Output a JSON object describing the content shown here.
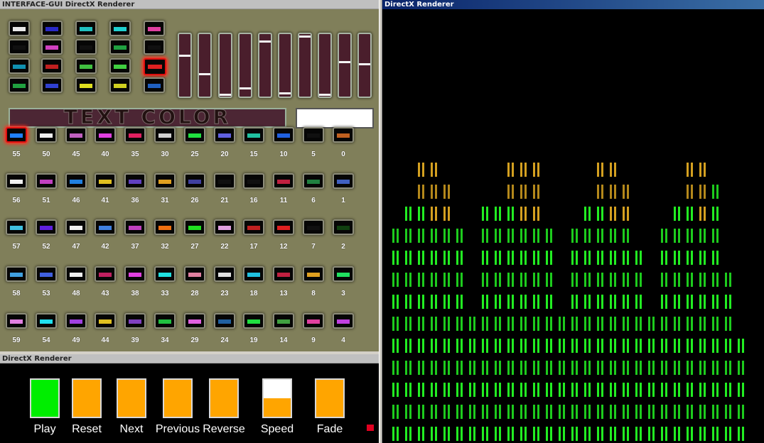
{
  "windows": {
    "gui_title": "INTERFACE-GUI   DirectX Renderer",
    "controls_title": "DirectX Renderer",
    "visualizer_title": "DirectX Renderer"
  },
  "text_color": {
    "label": "TEXT COLOR",
    "value": ""
  },
  "sliders": [
    {
      "level": 0.67
    },
    {
      "level": 0.35
    },
    {
      "level": 0.0
    },
    {
      "level": 0.11
    },
    {
      "level": 0.92
    },
    {
      "level": 0.03
    },
    {
      "level": 1.0
    },
    {
      "level": 0.0
    },
    {
      "level": 0.56
    },
    {
      "level": 0.53
    }
  ],
  "effect_grid_colors": [
    [
      "#e8e8e8",
      "#2a2ac8",
      "#20c0c0",
      "#20d0d0",
      "#e040a0"
    ],
    [
      "#101010",
      "#d040c0",
      "#101010",
      "#20a040",
      "#101010"
    ],
    [
      "#1090b0",
      "#c02020",
      "#40c040",
      "#40d040",
      "#e02020"
    ],
    [
      "#20a040",
      "#3040d0",
      "#e0e020",
      "#d0d020",
      "#2060c0"
    ]
  ],
  "effect_grid_selected": [
    2,
    4
  ],
  "presets": [
    [
      {
        "n": "55",
        "c": "#2080ff",
        "sel": true
      },
      {
        "n": "50",
        "c": "#f0f0f0"
      },
      {
        "n": "45",
        "c": "#c060c0"
      },
      {
        "n": "40",
        "c": "#e040e0"
      },
      {
        "n": "35",
        "c": "#e02060"
      },
      {
        "n": "30",
        "c": "#d0d0d0"
      },
      {
        "n": "25",
        "c": "#20e040"
      },
      {
        "n": "20",
        "c": "#6060e0"
      },
      {
        "n": "15",
        "c": "#20c0a0"
      },
      {
        "n": "10",
        "c": "#2060e0"
      },
      {
        "n": "5",
        "c": "#101010"
      },
      {
        "n": "0",
        "c": "#c06020"
      }
    ],
    [
      {
        "n": "56",
        "c": "#f0f0f0"
      },
      {
        "n": "51",
        "c": "#c040c0"
      },
      {
        "n": "46",
        "c": "#2080e0"
      },
      {
        "n": "41",
        "c": "#e0c020"
      },
      {
        "n": "36",
        "c": "#6040c0"
      },
      {
        "n": "31",
        "c": "#e0a020"
      },
      {
        "n": "26",
        "c": "#4040a0"
      },
      {
        "n": "21",
        "c": "#101010"
      },
      {
        "n": "16",
        "c": "#101010"
      },
      {
        "n": "11",
        "c": "#c02040"
      },
      {
        "n": "6",
        "c": "#208040"
      },
      {
        "n": "1",
        "c": "#4060c0"
      }
    ],
    [
      {
        "n": "57",
        "c": "#40c0e0"
      },
      {
        "n": "52",
        "c": "#6020e0"
      },
      {
        "n": "47",
        "c": "#f0f0f0"
      },
      {
        "n": "42",
        "c": "#4080e0"
      },
      {
        "n": "37",
        "c": "#c040c0"
      },
      {
        "n": "32",
        "c": "#f07010"
      },
      {
        "n": "27",
        "c": "#20e020"
      },
      {
        "n": "22",
        "c": "#e0a0e0"
      },
      {
        "n": "17",
        "c": "#c02020"
      },
      {
        "n": "12",
        "c": "#e02020"
      },
      {
        "n": "7",
        "c": "#101010"
      },
      {
        "n": "2",
        "c": "#104010"
      }
    ],
    [
      {
        "n": "58",
        "c": "#40a0e0"
      },
      {
        "n": "53",
        "c": "#4060e0"
      },
      {
        "n": "48",
        "c": "#f0f0f0"
      },
      {
        "n": "43",
        "c": "#c02060"
      },
      {
        "n": "38",
        "c": "#e040e0"
      },
      {
        "n": "33",
        "c": "#20e0e0"
      },
      {
        "n": "28",
        "c": "#e080a0"
      },
      {
        "n": "23",
        "c": "#e0e0e0"
      },
      {
        "n": "18",
        "c": "#20c0e0"
      },
      {
        "n": "13",
        "c": "#c02040"
      },
      {
        "n": "8",
        "c": "#e0a020"
      },
      {
        "n": "3",
        "c": "#20e060"
      }
    ],
    [
      {
        "n": "59",
        "c": "#e080e0"
      },
      {
        "n": "54",
        "c": "#20e0f0"
      },
      {
        "n": "49",
        "c": "#a040e0"
      },
      {
        "n": "44",
        "c": "#e0c020"
      },
      {
        "n": "39",
        "c": "#8040c0"
      },
      {
        "n": "34",
        "c": "#20c040"
      },
      {
        "n": "29",
        "c": "#e060e0"
      },
      {
        "n": "24",
        "c": "#2060a0"
      },
      {
        "n": "19",
        "c": "#20e040"
      },
      {
        "n": "14",
        "c": "#40a040"
      },
      {
        "n": "9",
        "c": "#e040a0"
      },
      {
        "n": "4",
        "c": "#c040e0"
      }
    ]
  ],
  "controls": [
    {
      "label": "Play",
      "color": "#00ee00",
      "fill": 1.0
    },
    {
      "label": "Reset",
      "color": "#ffa500",
      "fill": 1.0
    },
    {
      "label": "Next",
      "color": "#ffa500",
      "fill": 1.0
    },
    {
      "label": "Previous",
      "color": "#ffa500",
      "fill": 1.0
    },
    {
      "label": "Reverse",
      "color": "#ffa500",
      "fill": 1.0
    },
    {
      "label": "Speed",
      "color": "#ffa500",
      "fill": 0.5
    },
    {
      "label": "Fade",
      "color": "#ffa500",
      "fill": 1.0
    }
  ],
  "spectrum": {
    "bar_color": "#22ee22",
    "peak_color": "#d4a020",
    "background": "#000000",
    "levels": [
      0.75,
      0.85,
      1.0,
      0.95,
      0.93,
      0.7,
      0.45,
      0.78,
      0.8,
      1.0,
      0.97,
      0.95,
      0.7,
      0.45,
      0.7,
      0.82,
      1.0,
      0.95,
      0.93,
      0.68,
      0.45,
      0.72,
      0.8,
      1.0,
      0.95,
      0.9,
      0.6,
      0.35
    ]
  }
}
